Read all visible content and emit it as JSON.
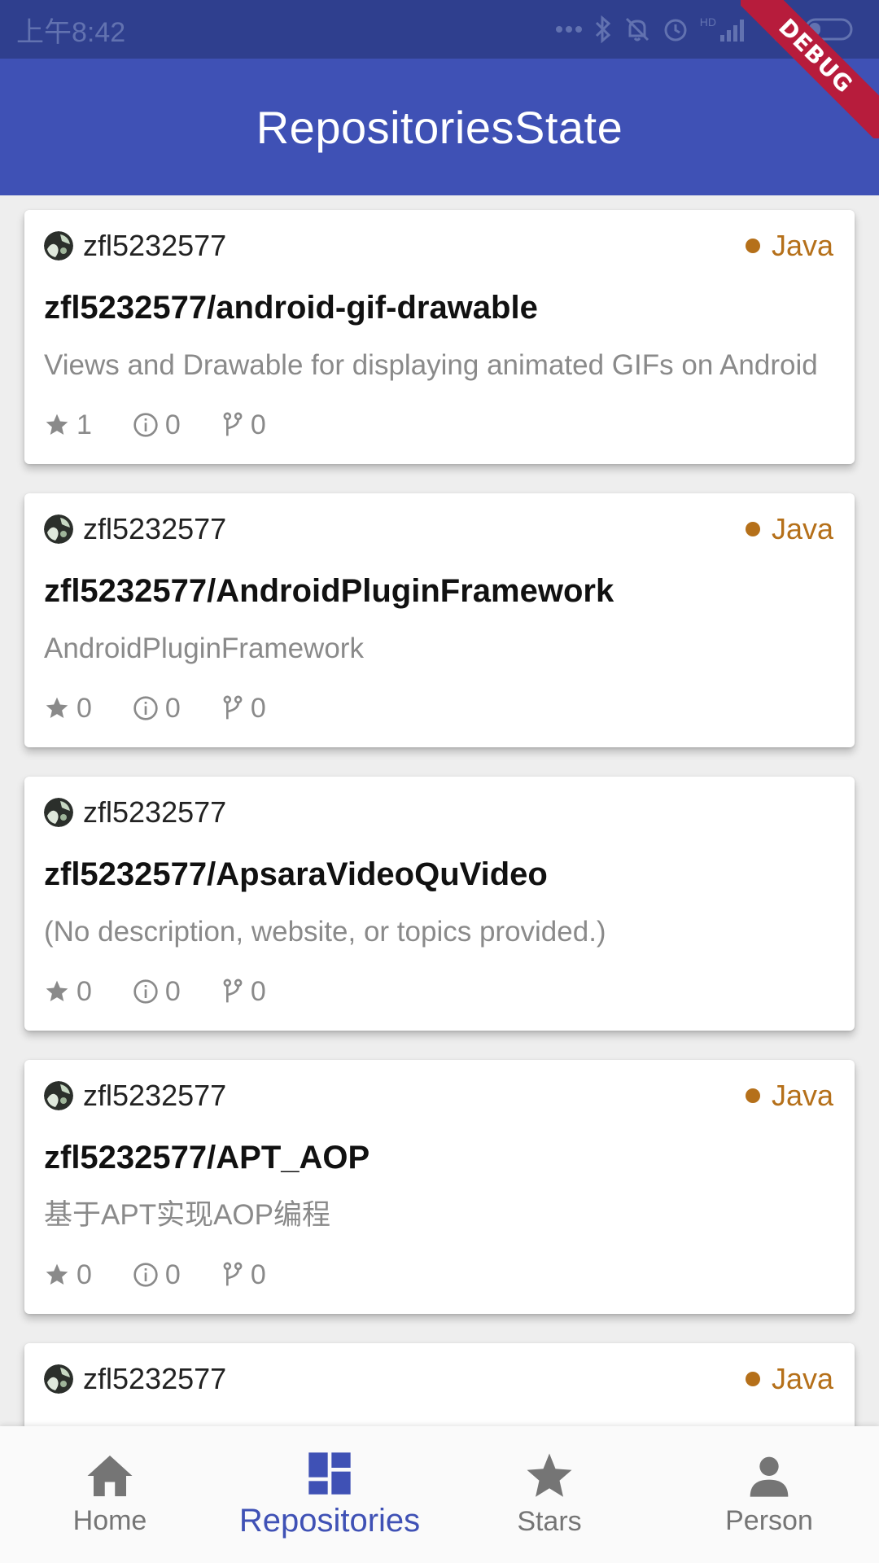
{
  "status_bar": {
    "time": "上午8:42",
    "hd_label": "HD"
  },
  "debug_banner": "DEBUG",
  "app_bar": {
    "title": "RepositoriesState"
  },
  "repositories": [
    {
      "owner": "zfl5232577",
      "language": "Java",
      "name": "zfl5232577/android-gif-drawable",
      "description": "Views and Drawable for displaying animated GIFs on Android",
      "stars": "1",
      "issues": "0",
      "forks": "0"
    },
    {
      "owner": "zfl5232577",
      "language": "Java",
      "name": "zfl5232577/AndroidPluginFramework",
      "description": "AndroidPluginFramework",
      "stars": "0",
      "issues": "0",
      "forks": "0"
    },
    {
      "owner": "zfl5232577",
      "language": "",
      "name": "zfl5232577/ApsaraVideoQuVideo",
      "description": "(No description, website, or topics provided.)",
      "stars": "0",
      "issues": "0",
      "forks": "0"
    },
    {
      "owner": "zfl5232577",
      "language": "Java",
      "name": "zfl5232577/APT_AOP",
      "description": "基于APT实现AOP编程",
      "stars": "0",
      "issues": "0",
      "forks": "0"
    },
    {
      "owner": "zfl5232577",
      "language": "Java",
      "name": "",
      "description": "",
      "stars": "",
      "issues": "",
      "forks": ""
    }
  ],
  "colors": {
    "primary": "#3f51b5",
    "language_java": "#b5701a"
  },
  "bottom_nav": {
    "items": [
      {
        "label": "Home",
        "icon": "home-icon"
      },
      {
        "label": "Repositories",
        "icon": "dashboard-icon"
      },
      {
        "label": "Stars",
        "icon": "star-icon"
      },
      {
        "label": "Person",
        "icon": "person-icon"
      }
    ],
    "active_index": 1
  }
}
